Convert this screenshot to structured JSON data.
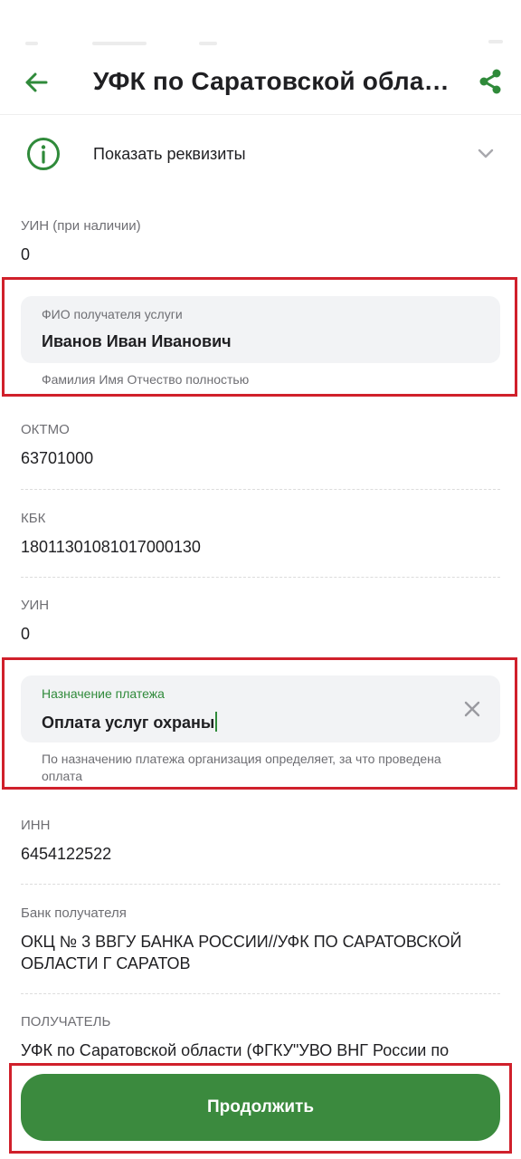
{
  "header": {
    "title": "УФК по Саратовской обла…"
  },
  "requisites": {
    "label": "Показать реквизиты"
  },
  "fields": {
    "uin_optional": {
      "label": "УИН (при наличии)",
      "value": "0"
    },
    "oktmo": {
      "label": "ОКТМО",
      "value": "63701000"
    },
    "kbk": {
      "label": "КБК",
      "value": "18011301081017000130"
    },
    "uin": {
      "label": "УИН",
      "value": "0"
    },
    "inn": {
      "label": "ИНН",
      "value": "6454122522"
    },
    "bank": {
      "label": "Банк получателя",
      "value": "ОКЦ № 3 ВВГУ БАНКА РОССИИ//УФК ПО САРАТОВСКОЙ ОБЛАСТИ Г САРАТОВ"
    },
    "recipient": {
      "label": "ПОЛУЧАТЕЛЬ",
      "value": "УФК по Саратовской области (ФГКУ\"УВО ВНГ России по"
    }
  },
  "fio_input": {
    "label": "ФИО получателя услуги",
    "value": "Иванов Иван Иванович",
    "hint": "Фамилия Имя Отчество полностью"
  },
  "purpose_input": {
    "label": "Назначение платежа",
    "value": "Оплата услуг охраны",
    "hint": "По назначению платежа организация определяет, за что проведена оплата"
  },
  "continue_button": {
    "label": "Продолжить"
  },
  "colors": {
    "accent": "#2f8a3a",
    "button": "#3b8a3e",
    "highlight": "#d0202b"
  },
  "icons": {
    "back": "arrow-left-icon",
    "share": "share-icon",
    "info": "info-circle-icon",
    "expand": "chevron-down-icon",
    "clear": "close-icon"
  }
}
